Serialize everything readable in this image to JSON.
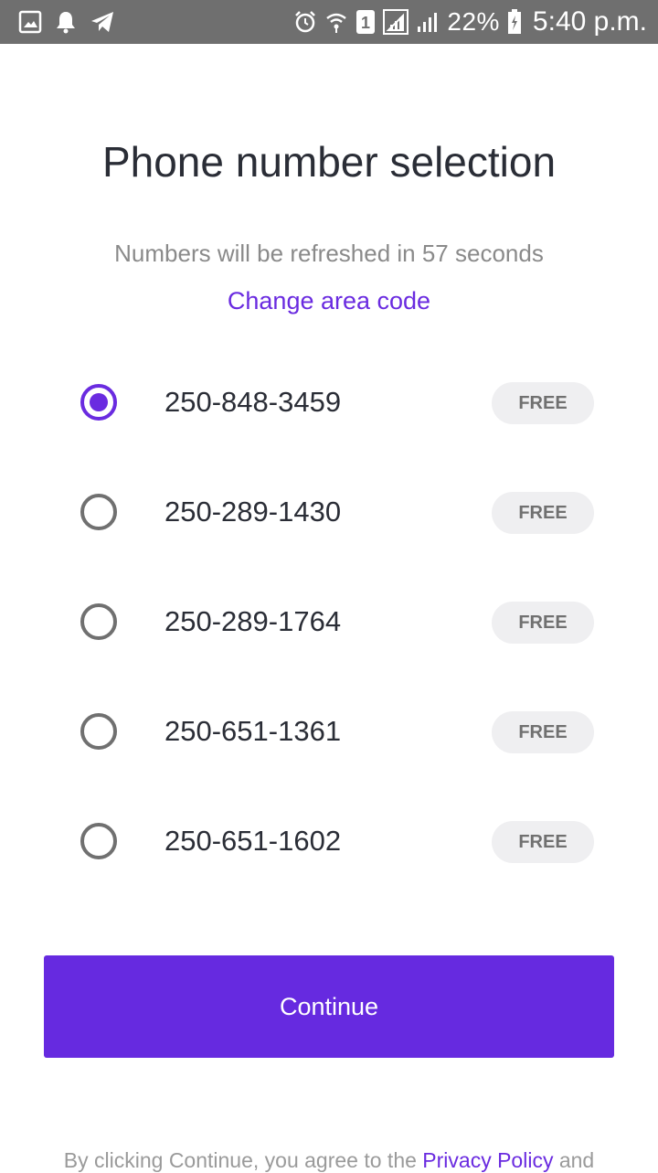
{
  "status_bar": {
    "battery": "22%",
    "time": "5:40 p.m.",
    "sim_slot": "1",
    "icons": [
      "image-icon",
      "bell-icon",
      "telegram-icon",
      "alarm-icon",
      "wifi-icon",
      "sim-icon",
      "signal-icon",
      "signal-icon",
      "battery-charging-icon"
    ]
  },
  "page": {
    "title": "Phone number selection",
    "refresh_text": "Numbers will be refreshed in 57 seconds",
    "change_area_code": "Change area code"
  },
  "numbers": [
    {
      "number": "250-848-3459",
      "badge": "FREE",
      "selected": true
    },
    {
      "number": "250-289-1430",
      "badge": "FREE",
      "selected": false
    },
    {
      "number": "250-289-1764",
      "badge": "FREE",
      "selected": false
    },
    {
      "number": "250-651-1361",
      "badge": "FREE",
      "selected": false
    },
    {
      "number": "250-651-1602",
      "badge": "FREE",
      "selected": false
    }
  ],
  "continue_label": "Continue",
  "footer": {
    "prefix": "By clicking Continue, you agree to the",
    "privacy_link": "Privacy Policy",
    "suffix": "and"
  },
  "colors": {
    "accent": "#662ae0",
    "status_bar": "#6f6f6f"
  }
}
